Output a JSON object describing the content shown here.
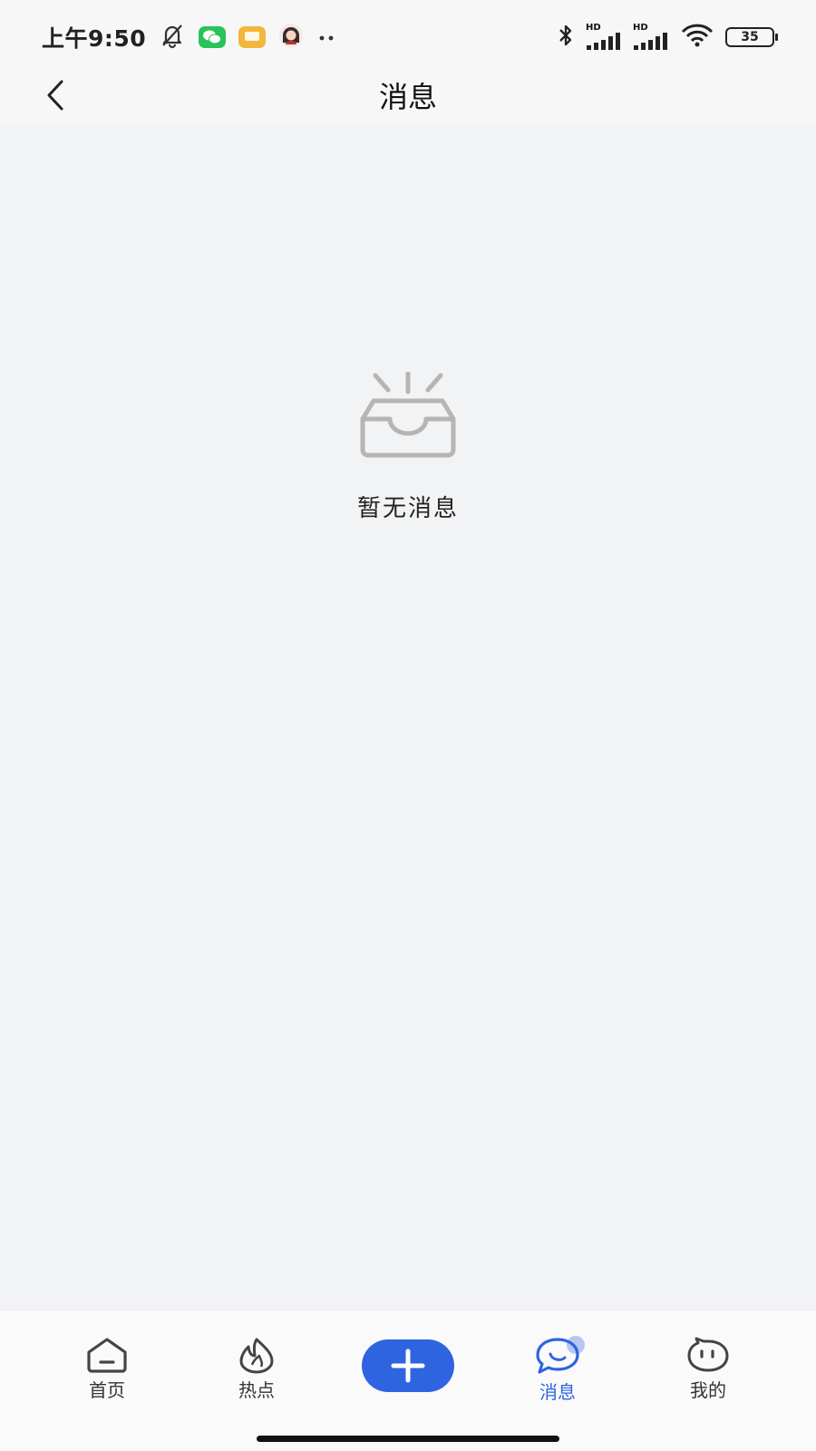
{
  "status_bar": {
    "time": "上午9:50",
    "battery_level": "35",
    "signal_1_label": "HD",
    "signal_2_label": "HD"
  },
  "header": {
    "title": "消息"
  },
  "empty_state": {
    "message": "暂无消息"
  },
  "tab_bar": {
    "tabs": [
      {
        "label": "首页",
        "icon": "home-icon"
      },
      {
        "label": "热点",
        "icon": "flame-icon"
      },
      {
        "label": "消息",
        "icon": "chat-bubble-icon",
        "active": true
      },
      {
        "label": "我的",
        "icon": "face-icon"
      }
    ],
    "add_icon": "plus-icon"
  },
  "colors": {
    "accent": "#2f64e0",
    "background": "#f2f3f5",
    "text": "#111111"
  }
}
